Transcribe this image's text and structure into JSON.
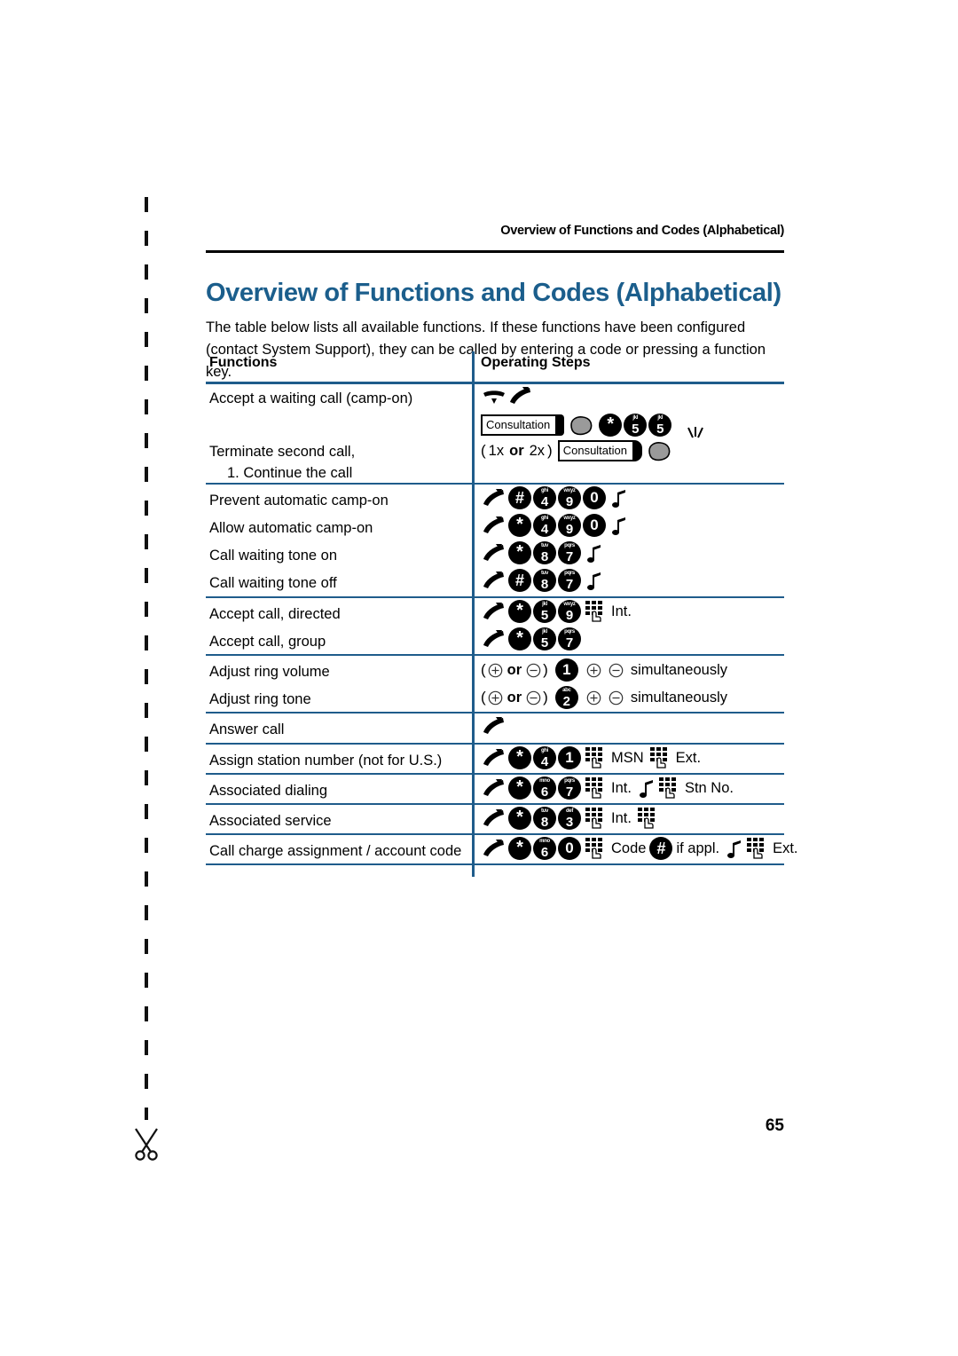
{
  "page": {
    "running_header": "Overview of Functions and Codes (Alphabetical)",
    "title": "Overview of Functions and Codes (Alphabetical)",
    "intro": "The table below lists all available functions. If these functions have been configured (contact System Support), they can be called by entering a code or pressing a function key.",
    "page_number": "65",
    "accent_color": "#1b5e8c",
    "rule_color": "#1f5c8b",
    "cut_icon": "scissors-icon"
  },
  "table": {
    "headers": {
      "functions": "Functions",
      "operating_steps": "Operating Steps"
    },
    "rows": [
      {
        "function": "Accept a waiting call (camp-on)",
        "steps_text": "hang-up-handset-icon lift-handset-icon"
      },
      {
        "function": "Terminate second call,",
        "function_sub": "1. Continue the call",
        "consultation_key_label": "Consultation",
        "star_key": "*",
        "key_5_digit": "5",
        "key_5_sub": "jkl",
        "press_count_open": "(",
        "press_count_1x": "1x",
        "press_count_or": "or",
        "press_count_2x": "2x",
        "press_count_close": ")"
      },
      {
        "function": "Prevent automatic camp-on",
        "code": [
          "#",
          "4",
          "9",
          "0"
        ],
        "code_subs": [
          "",
          "ghi",
          "wxyz",
          ""
        ],
        "tone": true
      },
      {
        "function": "Allow automatic camp-on",
        "code": [
          "*",
          "4",
          "9",
          "0"
        ],
        "code_subs": [
          "",
          "ghi",
          "wxyz",
          ""
        ],
        "tone": true
      },
      {
        "function": "Call waiting tone on",
        "code": [
          "*",
          "8",
          "7"
        ],
        "code_subs": [
          "",
          "tuv",
          "pqrs"
        ],
        "tone": true
      },
      {
        "function": "Call waiting tone off",
        "code": [
          "#",
          "8",
          "7"
        ],
        "code_subs": [
          "",
          "tuv",
          "pqrs"
        ],
        "tone": true
      },
      {
        "function": "Accept call, directed",
        "code": [
          "*",
          "5",
          "9"
        ],
        "code_subs": [
          "",
          "jkl",
          "wxyz"
        ],
        "after_label": "Int."
      },
      {
        "function": "Accept call, group",
        "code": [
          "*",
          "5",
          "7"
        ],
        "code_subs": [
          "",
          "jkl",
          "pqrs"
        ]
      },
      {
        "function": "Adjust ring volume",
        "vol_prefix_open": "(",
        "vol_or": "or",
        "vol_prefix_close": ")",
        "key": "1",
        "key_sub": "",
        "vol_suffix": "simultaneously"
      },
      {
        "function": "Adjust ring tone",
        "vol_prefix_open": "(",
        "vol_or": "or",
        "vol_prefix_close": ")",
        "key": "2",
        "key_sub": "abc",
        "vol_suffix": "simultaneously"
      },
      {
        "function": "Answer call",
        "steps_text": "lift-handset-icon"
      },
      {
        "function": "Assign station number (not for U.S.)",
        "code": [
          "*",
          "4",
          "1"
        ],
        "code_subs": [
          "",
          "ghi",
          ""
        ],
        "label_1": "MSN",
        "label_2": "Ext."
      },
      {
        "function": "Associated dialing",
        "code": [
          "*",
          "6",
          "7"
        ],
        "code_subs": [
          "",
          "mno",
          "pqrs"
        ],
        "label_1": "Int.",
        "label_2": "Stn No."
      },
      {
        "function": "Associated service",
        "code": [
          "*",
          "8",
          "3"
        ],
        "code_subs": [
          "",
          "tuv",
          "def"
        ],
        "label_1": "Int."
      },
      {
        "function": "Call charge assignment / account code",
        "code": [
          "*",
          "6",
          "0"
        ],
        "code_subs": [
          "",
          "mno",
          ""
        ],
        "label_1": "Code",
        "hash_key": "#",
        "label_2": "if appl.",
        "label_3": "Ext."
      }
    ]
  }
}
